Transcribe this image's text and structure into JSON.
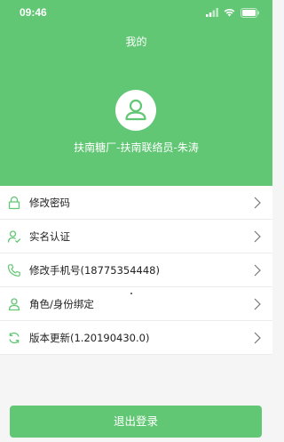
{
  "status_bar": {
    "time": "09:46"
  },
  "header": {
    "title": "我的",
    "user_name": "扶南糖厂-扶南联络员-朱涛"
  },
  "menu": {
    "items": [
      {
        "label": "修改密码",
        "icon": "lock-icon"
      },
      {
        "label": "实名认证",
        "icon": "user-check-icon"
      },
      {
        "label": "修改手机号(18775354448)",
        "icon": "phone-icon"
      },
      {
        "label": "角色/身份绑定",
        "icon": "person-icon"
      },
      {
        "label": "版本更新(1.20190430.0)",
        "icon": "refresh-icon"
      }
    ]
  },
  "logout": {
    "label": "退出登录"
  },
  "colors": {
    "accent": "#61c774",
    "background": "#f5f5f5"
  }
}
